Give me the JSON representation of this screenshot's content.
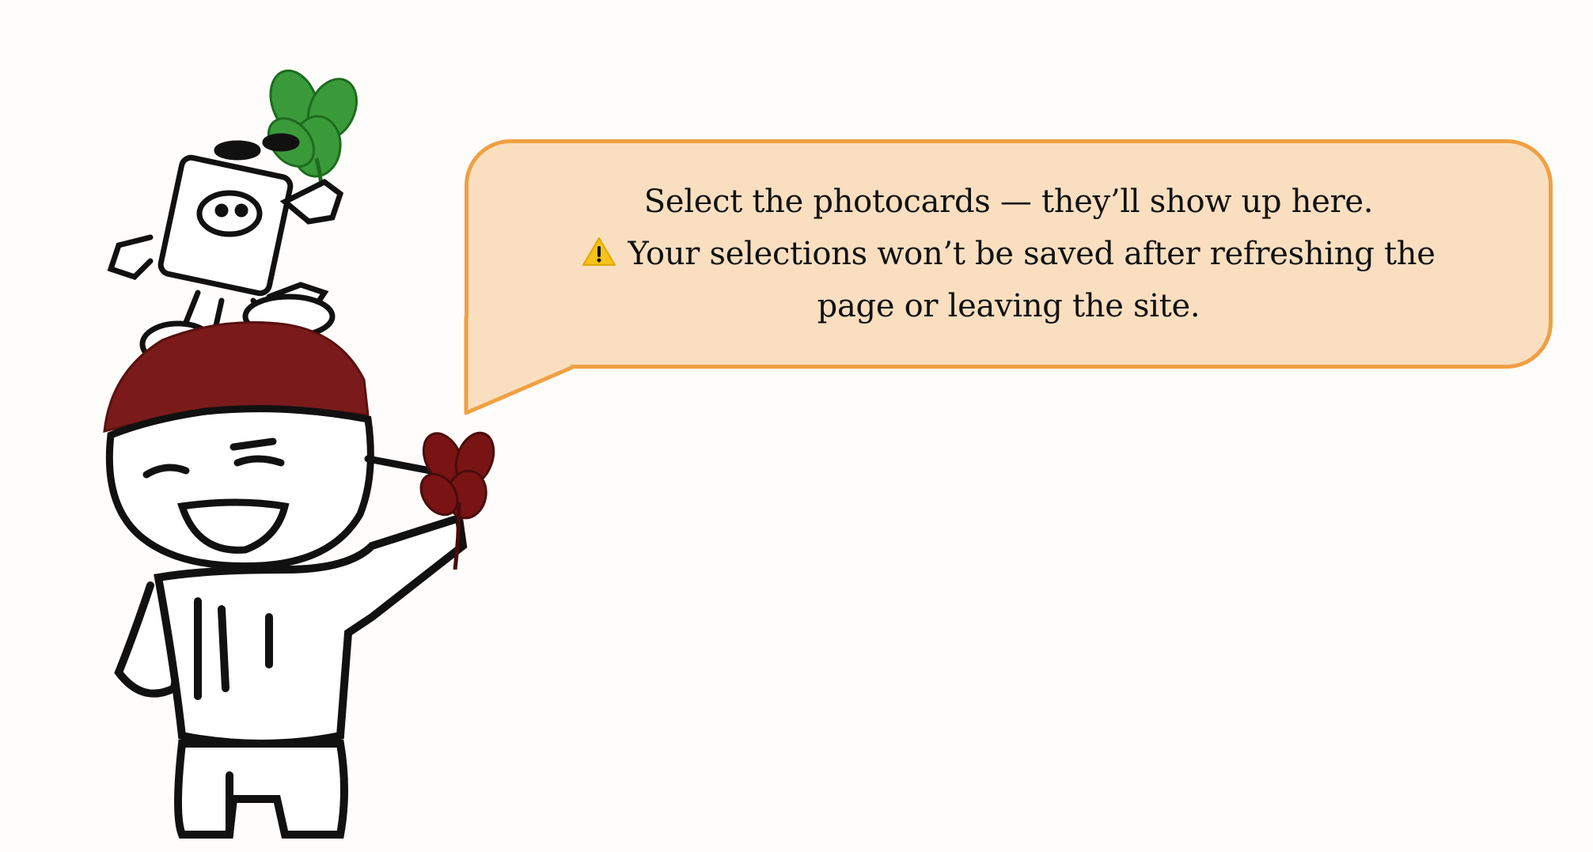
{
  "speech_bubble": {
    "line1": "Select the photocards — they’ll show up here.",
    "line2": "Your selections won’t be saved after refreshing the",
    "line3": "page or leaving the site.",
    "warning_icon": "warning-triangle-icon"
  },
  "mascot": {
    "name": "mascot-illustration",
    "accents": {
      "hair": "#7a1a1a",
      "clover_green": "#2f8f2f",
      "clover_red": "#7a1414"
    }
  },
  "colors": {
    "bubble_fill": "#f9dfc0",
    "bubble_border": "#f0a043",
    "background": "#fffdfb"
  }
}
